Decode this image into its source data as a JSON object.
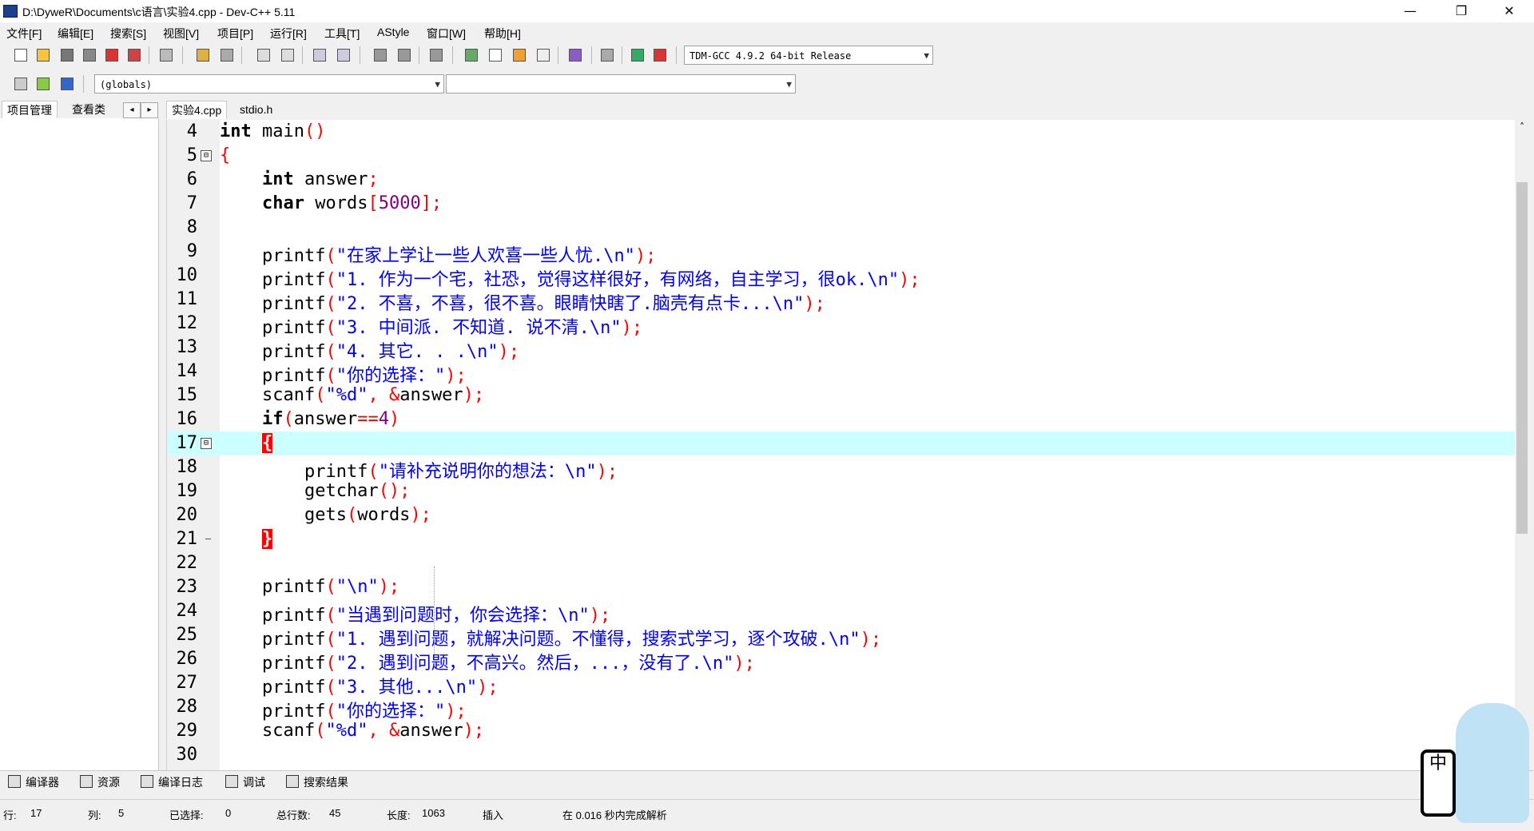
{
  "window": {
    "title": "D:\\DyweR\\Documents\\c语言\\实验4.cpp - Dev-C++ 5.11",
    "minimize_glyph": "—",
    "restore_glyph": "❐",
    "close_glyph": "✕"
  },
  "menubar": [
    {
      "label": "文件[F]"
    },
    {
      "label": "编辑[E]"
    },
    {
      "label": "搜索[S]"
    },
    {
      "label": "视图[V]"
    },
    {
      "label": "项目[P]"
    },
    {
      "label": "运行[R]"
    },
    {
      "label": "工具[T]"
    },
    {
      "label": "AStyle"
    },
    {
      "label": "窗口[W]"
    },
    {
      "label": "帮助[H]"
    }
  ],
  "toolbar": {
    "compiler_select": "TDM-GCC 4.9.2 64-bit Release",
    "scope_select": "(globals)",
    "symbol_select": ""
  },
  "left_panel": {
    "tabs": [
      "项目管理",
      "查看类"
    ],
    "nav_prev": "◂",
    "nav_next": "▸"
  },
  "file_tabs": [
    "实验4.cpp",
    "stdio.h"
  ],
  "editor": {
    "current_line": 17,
    "lines": [
      {
        "n": "4",
        "fold": "",
        "segs": [
          [
            "kw",
            "int"
          ],
          [
            "id",
            " main"
          ],
          [
            "sym",
            "()"
          ]
        ]
      },
      {
        "n": "5",
        "fold": "⊟",
        "segs": [
          [
            "sym",
            "{"
          ]
        ]
      },
      {
        "n": "6",
        "fold": "",
        "segs": [
          [
            "id",
            "    "
          ],
          [
            "kw",
            "int"
          ],
          [
            "id",
            " answer"
          ],
          [
            "sym",
            ";"
          ]
        ]
      },
      {
        "n": "7",
        "fold": "",
        "segs": [
          [
            "id",
            "    "
          ],
          [
            "kw",
            "char"
          ],
          [
            "id",
            " words"
          ],
          [
            "sym",
            "["
          ],
          [
            "num",
            "5000"
          ],
          [
            "sym",
            "];"
          ]
        ]
      },
      {
        "n": "8",
        "fold": "",
        "segs": []
      },
      {
        "n": "9",
        "fold": "",
        "segs": [
          [
            "id",
            "    printf"
          ],
          [
            "sym",
            "("
          ],
          [
            "str",
            "\"在家上学让一些人欢喜一些人忧.\\n\""
          ],
          [
            "sym",
            ");"
          ]
        ]
      },
      {
        "n": "10",
        "fold": "",
        "segs": [
          [
            "id",
            "    printf"
          ],
          [
            "sym",
            "("
          ],
          [
            "str",
            "\"1. 作为一个宅，社恐，觉得这样很好，有网络，自主学习，很ok.\\n\""
          ],
          [
            "sym",
            ");"
          ]
        ]
      },
      {
        "n": "11",
        "fold": "",
        "segs": [
          [
            "id",
            "    printf"
          ],
          [
            "sym",
            "("
          ],
          [
            "str",
            "\"2. 不喜，不喜，很不喜。眼睛快瞎了.脑壳有点卡...\\n\""
          ],
          [
            "sym",
            ");"
          ]
        ]
      },
      {
        "n": "12",
        "fold": "",
        "segs": [
          [
            "id",
            "    printf"
          ],
          [
            "sym",
            "("
          ],
          [
            "str",
            "\"3. 中间派. 不知道. 说不清.\\n\""
          ],
          [
            "sym",
            ");"
          ]
        ]
      },
      {
        "n": "13",
        "fold": "",
        "segs": [
          [
            "id",
            "    printf"
          ],
          [
            "sym",
            "("
          ],
          [
            "str",
            "\"4. 其它. . .\\n\""
          ],
          [
            "sym",
            ");"
          ]
        ]
      },
      {
        "n": "14",
        "fold": "",
        "segs": [
          [
            "id",
            "    printf"
          ],
          [
            "sym",
            "("
          ],
          [
            "str",
            "\"你的选择：\""
          ],
          [
            "sym",
            ");"
          ]
        ]
      },
      {
        "n": "15",
        "fold": "",
        "segs": [
          [
            "id",
            "    scanf"
          ],
          [
            "sym",
            "("
          ],
          [
            "str",
            "\"%d\""
          ],
          [
            "sym",
            ", &"
          ],
          [
            "id",
            "answer"
          ],
          [
            "sym",
            ");"
          ]
        ]
      },
      {
        "n": "16",
        "fold": "",
        "segs": [
          [
            "id",
            "    "
          ],
          [
            "kw",
            "if"
          ],
          [
            "sym",
            "("
          ],
          [
            "id",
            "answer"
          ],
          [
            "sym",
            "=="
          ],
          [
            "num",
            "4"
          ],
          [
            "sym",
            ")"
          ]
        ]
      },
      {
        "n": "17",
        "fold": "⊟",
        "segs": [
          [
            "id",
            "    "
          ],
          [
            "br",
            "{"
          ]
        ]
      },
      {
        "n": "18",
        "fold": "",
        "segs": [
          [
            "id",
            "        printf"
          ],
          [
            "sym",
            "("
          ],
          [
            "str",
            "\"请补充说明你的想法：\\n\""
          ],
          [
            "sym",
            ");"
          ]
        ]
      },
      {
        "n": "19",
        "fold": "",
        "segs": [
          [
            "id",
            "        getchar"
          ],
          [
            "sym",
            "();"
          ]
        ]
      },
      {
        "n": "20",
        "fold": "",
        "segs": [
          [
            "id",
            "        gets"
          ],
          [
            "sym",
            "("
          ],
          [
            "id",
            "words"
          ],
          [
            "sym",
            ");"
          ]
        ]
      },
      {
        "n": "21",
        "fold": "end",
        "segs": [
          [
            "id",
            "    "
          ],
          [
            "br",
            "}"
          ]
        ]
      },
      {
        "n": "22",
        "fold": "",
        "segs": []
      },
      {
        "n": "23",
        "fold": "",
        "segs": [
          [
            "id",
            "    printf"
          ],
          [
            "sym",
            "("
          ],
          [
            "str",
            "\"\\n\""
          ],
          [
            "sym",
            ");"
          ]
        ]
      },
      {
        "n": "24",
        "fold": "",
        "segs": [
          [
            "id",
            "    printf"
          ],
          [
            "sym",
            "("
          ],
          [
            "str",
            "\"当遇到问题时，你会选择：\\n\""
          ],
          [
            "sym",
            ");"
          ]
        ]
      },
      {
        "n": "25",
        "fold": "",
        "segs": [
          [
            "id",
            "    printf"
          ],
          [
            "sym",
            "("
          ],
          [
            "str",
            "\"1. 遇到问题，就解决问题。不懂得，搜索式学习，逐个攻破.\\n\""
          ],
          [
            "sym",
            ");"
          ]
        ]
      },
      {
        "n": "26",
        "fold": "",
        "segs": [
          [
            "id",
            "    printf"
          ],
          [
            "sym",
            "("
          ],
          [
            "str",
            "\"2. 遇到问题，不高兴。然后，...，没有了.\\n\""
          ],
          [
            "sym",
            ");"
          ]
        ]
      },
      {
        "n": "27",
        "fold": "",
        "segs": [
          [
            "id",
            "    printf"
          ],
          [
            "sym",
            "("
          ],
          [
            "str",
            "\"3. 其他...\\n\""
          ],
          [
            "sym",
            ");"
          ]
        ]
      },
      {
        "n": "28",
        "fold": "",
        "segs": [
          [
            "id",
            "    printf"
          ],
          [
            "sym",
            "("
          ],
          [
            "str",
            "\"你的选择：\""
          ],
          [
            "sym",
            ");"
          ]
        ]
      },
      {
        "n": "29",
        "fold": "",
        "segs": [
          [
            "id",
            "    scanf"
          ],
          [
            "sym",
            "("
          ],
          [
            "str",
            "\"%d\""
          ],
          [
            "sym",
            ", &"
          ],
          [
            "id",
            "answer"
          ],
          [
            "sym",
            ");"
          ]
        ]
      },
      {
        "n": "30",
        "fold": "",
        "segs": []
      }
    ]
  },
  "scrollbar": {
    "up_glyph": "˄"
  },
  "bottom_tabs": [
    "编译器",
    "资源",
    "编译日志",
    "调试",
    "搜索结果"
  ],
  "status": {
    "line_label": "行:",
    "line_value": "17",
    "col_label": "列:",
    "col_value": "5",
    "sel_label": "已选择:",
    "sel_value": "0",
    "total_label": "总行数:",
    "total_value": "45",
    "len_label": "长度:",
    "len_value": "1063",
    "mode": "插入",
    "parse": "在 0.016 秒内完成解析"
  },
  "ime": {
    "label": "中"
  },
  "colors": {
    "current_line": "#ccffff",
    "string": "#0000ff",
    "symbol": "#ff0000",
    "number": "#800080"
  }
}
